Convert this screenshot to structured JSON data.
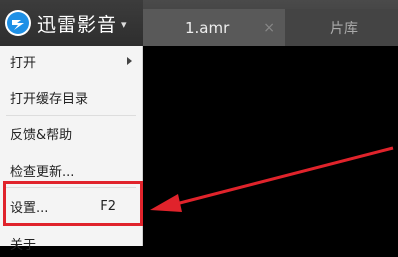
{
  "app": {
    "brand_name": "迅雷影音",
    "brand_caret": "▾"
  },
  "tabs": [
    {
      "label": "1.amr",
      "close": "×"
    },
    {
      "label": "片库"
    }
  ],
  "menu": {
    "items": [
      {
        "label": "打开"
      },
      {
        "label": "打开缓存目录"
      },
      {
        "label": "反馈&帮助"
      },
      {
        "label": "检查更新..."
      },
      {
        "label": "设置...",
        "shortcut": "F2"
      },
      {
        "label": "关于"
      }
    ]
  },
  "colors": {
    "highlight": "#e0232b",
    "logo": "#1e90e6"
  }
}
